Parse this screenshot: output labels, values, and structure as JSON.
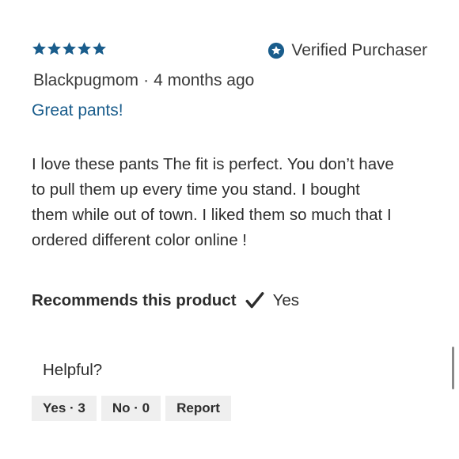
{
  "rating": {
    "value": 5,
    "max": 5,
    "star_color": "#1a5d8c"
  },
  "verified": {
    "label": "Verified Purchaser",
    "icon": "star-badge-icon",
    "color": "#1a5d8c"
  },
  "byline": {
    "author": "Blackpugmom",
    "separator": "·",
    "time": "4 months ago"
  },
  "review": {
    "title": "Great pants!",
    "body": "I love these pants The fit is perfect. You don’t have to pull them up every time you stand. I bought them while out of town. I liked them so much that I ordered different color online !"
  },
  "recommends": {
    "label": "Recommends this product",
    "icon": "checkmark-icon",
    "value": "Yes"
  },
  "helpful": {
    "label": "Helpful?",
    "yes_label": "Yes · 3",
    "no_label": "No · 0",
    "report_label": "Report"
  }
}
